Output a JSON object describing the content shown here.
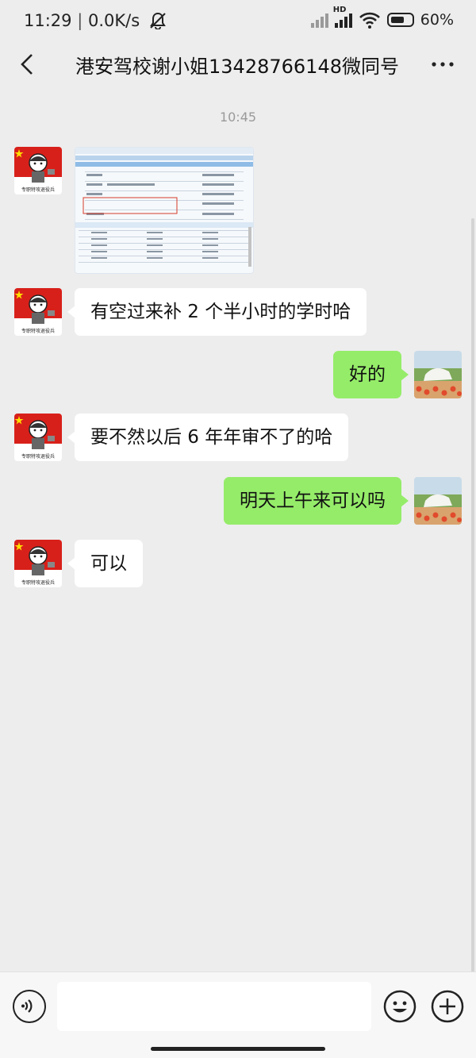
{
  "status": {
    "time": "11:29",
    "speed": "0.0K/s",
    "network_badge": "HD",
    "battery_percent": "60%"
  },
  "header": {
    "title": "港安驾校谢小姐13428766148微同号"
  },
  "timestamp": "10:45",
  "contact_avatar_caption": "专职特攻退役兵",
  "messages": [
    {
      "from": "contact",
      "type": "image"
    },
    {
      "from": "contact",
      "text": "有空过来补 2 个半小时的学时哈"
    },
    {
      "from": "me",
      "text": "好的"
    },
    {
      "from": "contact",
      "text": "要不然以后 6 年年审不了的哈"
    },
    {
      "from": "me",
      "text": "明天上午来可以吗"
    },
    {
      "from": "contact",
      "text": "可以"
    }
  ],
  "icons": {
    "back": "chevron-left-icon",
    "more": "more-dots-icon",
    "voice": "voice-icon",
    "emoji": "emoji-icon",
    "plus": "plus-icon"
  },
  "colors": {
    "chat_background": "#ededed",
    "outgoing_bubble": "#95ec69",
    "incoming_bubble": "#ffffff"
  }
}
